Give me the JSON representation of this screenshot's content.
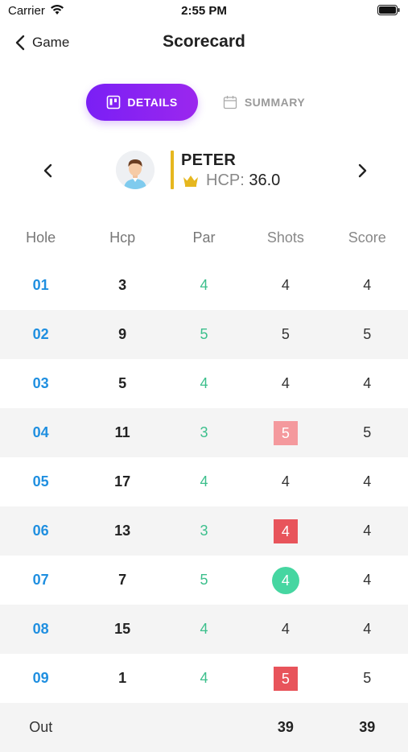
{
  "status_bar": {
    "carrier": "Carrier",
    "time": "2:55 PM"
  },
  "nav": {
    "back_label": "Game",
    "title": "Scorecard"
  },
  "tabs": [
    {
      "label": "DETAILS",
      "icon": "board-icon",
      "active": true
    },
    {
      "label": "SUMMARY",
      "icon": "calendar-icon",
      "active": false
    }
  ],
  "player": {
    "name": "PETER",
    "hcp_label": "HCP:",
    "hcp_value": "36.0"
  },
  "colors": {
    "accent": "#8a22f2",
    "hole": "#1f8fe0",
    "par": "#3cbf8c",
    "crown": "#e6b71f",
    "pink": "#f4999d",
    "red": "#e8545b",
    "green": "#46d6a1"
  },
  "table": {
    "headers": [
      "Hole",
      "Hcp",
      "Par",
      "Shots",
      "Score"
    ],
    "rows": [
      {
        "hole": "01",
        "hcp": "3",
        "par": "4",
        "shots": "4",
        "score": "4",
        "mark": "none"
      },
      {
        "hole": "02",
        "hcp": "9",
        "par": "5",
        "shots": "5",
        "score": "5",
        "mark": "none"
      },
      {
        "hole": "03",
        "hcp": "5",
        "par": "4",
        "shots": "4",
        "score": "4",
        "mark": "none"
      },
      {
        "hole": "04",
        "hcp": "11",
        "par": "3",
        "shots": "5",
        "score": "5",
        "mark": "pink"
      },
      {
        "hole": "05",
        "hcp": "17",
        "par": "4",
        "shots": "4",
        "score": "4",
        "mark": "none"
      },
      {
        "hole": "06",
        "hcp": "13",
        "par": "3",
        "shots": "4",
        "score": "4",
        "mark": "red"
      },
      {
        "hole": "07",
        "hcp": "7",
        "par": "5",
        "shots": "4",
        "score": "4",
        "mark": "green"
      },
      {
        "hole": "08",
        "hcp": "15",
        "par": "4",
        "shots": "4",
        "score": "4",
        "mark": "none"
      },
      {
        "hole": "09",
        "hcp": "1",
        "par": "4",
        "shots": "5",
        "score": "5",
        "mark": "red"
      }
    ],
    "total": {
      "label": "Out",
      "hcp": "",
      "par": "",
      "shots": "39",
      "score": "39"
    }
  }
}
